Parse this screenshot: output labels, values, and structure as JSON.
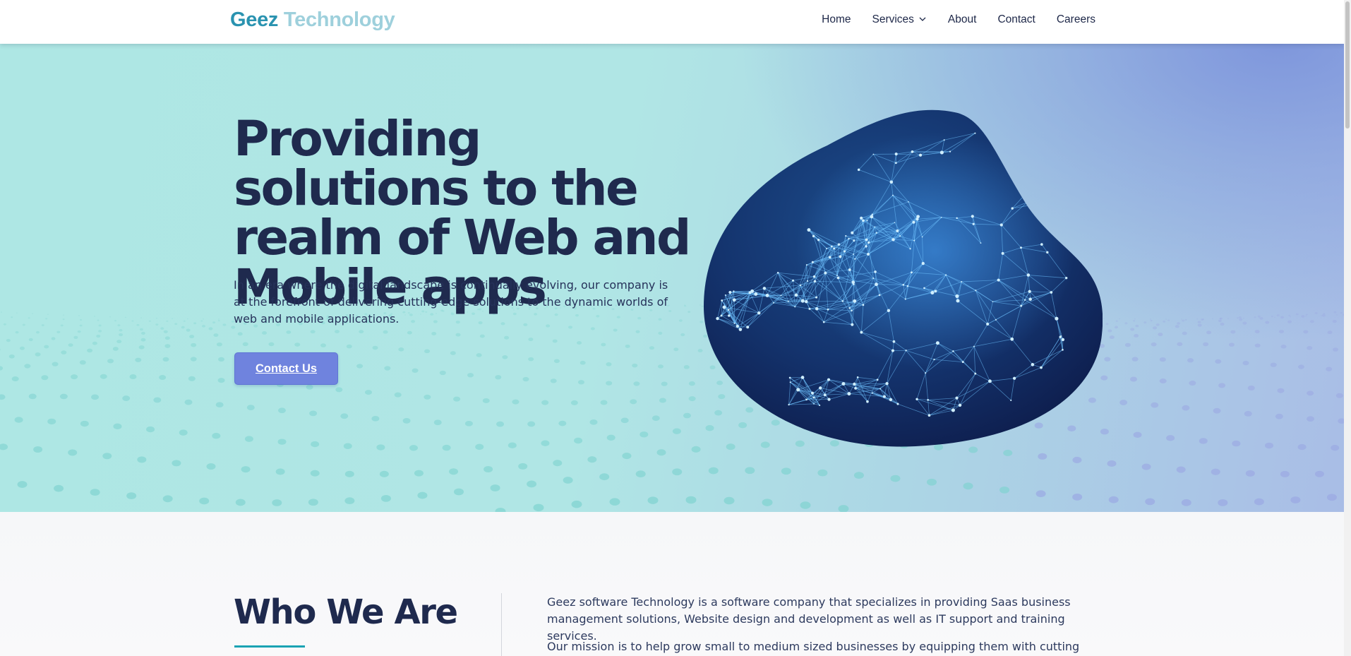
{
  "header": {
    "logo_part1": "Geez",
    "logo_part2": "Technology",
    "nav": [
      {
        "label": "Home"
      },
      {
        "label": "Services",
        "icon": "chevron-down-icon"
      },
      {
        "label": "About"
      },
      {
        "label": "Contact"
      },
      {
        "label": "Careers"
      }
    ]
  },
  "hero": {
    "title": "Providing solutions to the realm of Web and Mobile apps",
    "description": "In an era where the digital landscape is continually evolving, our company is at the forefront of delivering cutting-edge solutions to the dynamic worlds of web and mobile applications.",
    "cta_label": "Contact Us"
  },
  "who": {
    "title": "Who We Are",
    "paragraph1": "Geez software Technology is a software company that specializes in providing Saas business management solutions, Website design and development as well as IT support and training services.",
    "paragraph2": "Our mission is to help grow small to medium sized businesses by equipping them with cutting edge"
  },
  "colors": {
    "brand_dark": "#2a93b0",
    "brand_light": "#9ed0dc",
    "heading": "#1f2a4e",
    "button": "#6f83de",
    "accent_underline": "#1aa3b3"
  }
}
